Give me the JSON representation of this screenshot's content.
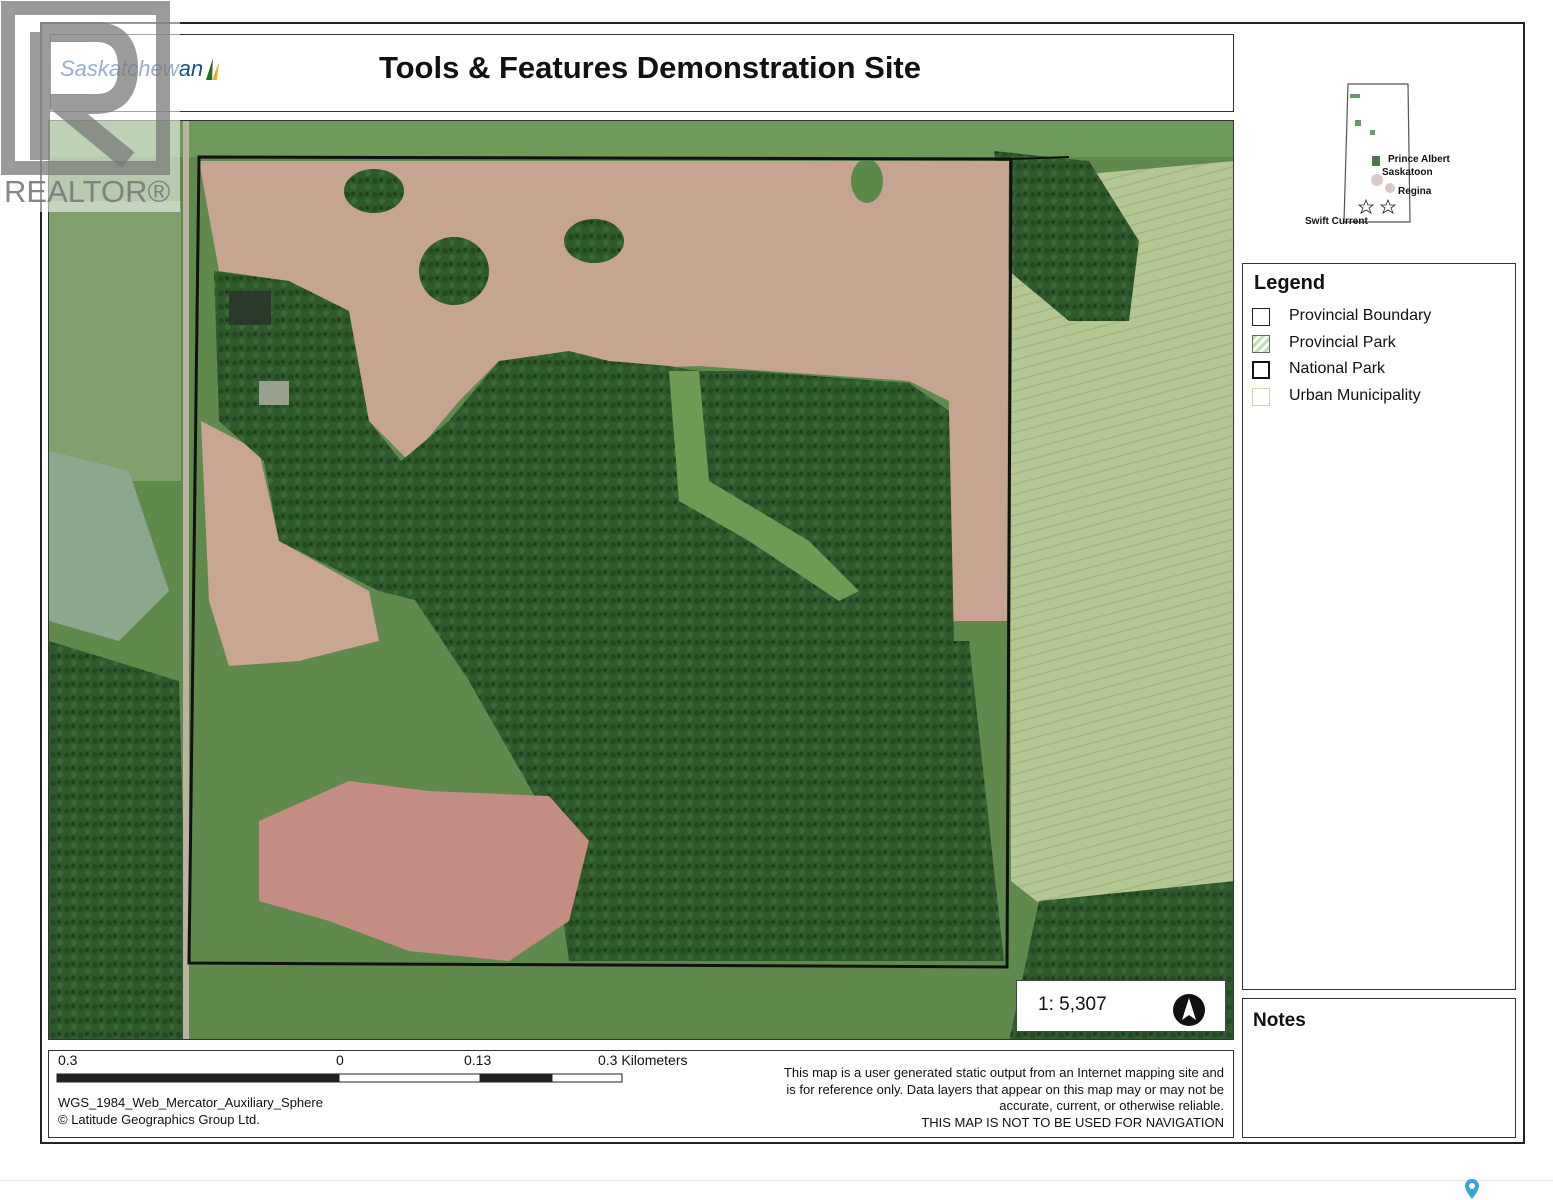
{
  "header": {
    "title": "Tools & Features Demonstration Site",
    "logo_text": "Saskatchewan"
  },
  "map": {
    "imagery": "satellite aerial farmland with forest block",
    "colors": {
      "boundary": "#111111",
      "field": "#c9a08a",
      "forest": "#2e5a2c",
      "grass": "#6f9a5a"
    }
  },
  "scale": {
    "ratio": "1: 5,307",
    "bar_labels": [
      "0.3",
      "0",
      "0.13",
      "0.3 Kilometers"
    ]
  },
  "north_arrow_icon": "north-arrow-icon",
  "footer": {
    "projection": "WGS_1984_Web_Mercator_Auxiliary_Sphere",
    "copyright": "© Latitude Geographics Group Ltd.",
    "disclaimer": [
      "This map is a user generated static output from an Internet mapping site and",
      "is for reference only. Data layers that appear on this map may or may not be",
      "accurate, current, or otherwise reliable.",
      "THIS MAP IS NOT TO BE USED FOR NAVIGATION"
    ]
  },
  "inset": {
    "cities": [
      "Prince Albert",
      "Saskatoon",
      "Regina",
      "Swift Current"
    ]
  },
  "legend": {
    "title": "Legend",
    "items": [
      {
        "label": "Provincial Boundary",
        "swatch": "#ffffff",
        "border": "#222222"
      },
      {
        "label": "Provincial Park",
        "swatch": "#bfe0b5",
        "border": "#666666"
      },
      {
        "label": "National Park",
        "swatch": "#ffffff",
        "border": "#111111"
      },
      {
        "label": "Urban Municipality",
        "swatch": "#ffffff",
        "border": "#d8d2b0"
      }
    ]
  },
  "notes": {
    "title": "Notes"
  },
  "watermark": {
    "text": "REALTOR®"
  }
}
